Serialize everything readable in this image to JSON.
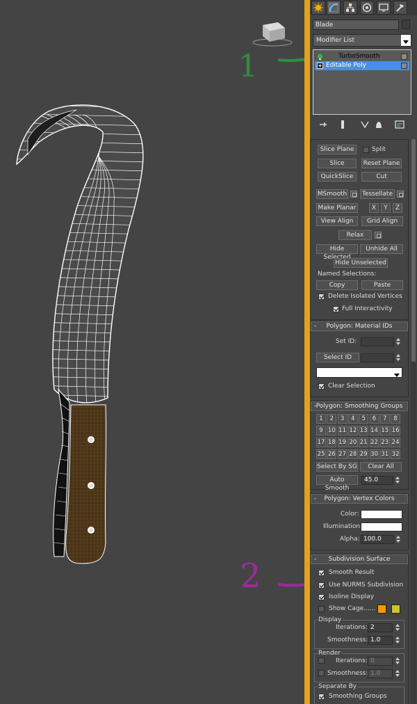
{
  "command_panel": {
    "tabs": [
      "create-icon",
      "modify-icon",
      "hierarchy-icon",
      "motion-icon",
      "display-icon",
      "utilities-icon"
    ],
    "object_name": "Blade",
    "modifier_list": "Modifier List",
    "stack": [
      {
        "label": "TurboSmooth"
      },
      {
        "label": "Editable Poly",
        "selected": true
      }
    ]
  },
  "viewport": {
    "annotations": [
      {
        "text": "1",
        "color": "#2f8f3f"
      },
      {
        "text": "2",
        "color": "#9a2c9a"
      }
    ]
  },
  "edit_geometry": {
    "slice_plane": "Slice Plane",
    "split": "Split",
    "slice": "Slice",
    "reset_plane": "Reset Plane",
    "quickslice": "QuickSlice",
    "cut": "Cut",
    "msmooth": "MSmooth",
    "tessellate": "Tessellate",
    "make_planar": "Make Planar",
    "x": "X",
    "y": "Y",
    "z": "Z",
    "view_align": "View Align",
    "grid_align": "Grid Align",
    "relax": "Relax",
    "hide_selected": "Hide Selected",
    "unhide_all": "Unhide All",
    "hide_unselected": "Hide Unselected",
    "named_selections": "Named Selections:",
    "copy": "Copy",
    "paste": "Paste",
    "delete_isolated": "Delete Isolated Vertices",
    "full_interactivity": "Full Interactivity"
  },
  "material_ids": {
    "title": "Polygon: Material IDs",
    "set_id": "Set ID:",
    "select_id": "Select ID",
    "clear_selection": "Clear Selection"
  },
  "smoothing_groups": {
    "title": "Polygon: Smoothing Groups",
    "numbers": [
      "1",
      "2",
      "3",
      "4",
      "5",
      "6",
      "7",
      "8",
      "9",
      "10",
      "11",
      "12",
      "13",
      "14",
      "15",
      "16",
      "17",
      "18",
      "19",
      "20",
      "21",
      "22",
      "23",
      "24",
      "25",
      "26",
      "27",
      "28",
      "29",
      "30",
      "31",
      "32"
    ],
    "select_by_sg": "Select By SG",
    "clear_all": "Clear All",
    "auto_smooth": "Auto Smooth",
    "auto_smooth_value": "45.0"
  },
  "vertex_colors": {
    "title": "Polygon: Vertex Colors",
    "color": "Color:",
    "illumination": "Illumination:",
    "alpha": "Alpha:",
    "alpha_value": "100.0"
  },
  "subdivision": {
    "title": "Subdivision Surface",
    "smooth_result": "Smooth Result",
    "use_nurms": "Use NURMS Subdivision",
    "isoline_display": "Isoline Display",
    "show_cage": "Show Cage......",
    "cage_color_1": "#f59a00",
    "cage_color_2": "#cfc42a",
    "display_label": "Display",
    "iterations": "Iterations:",
    "iterations_value": "2",
    "smoothness": "Smoothness:",
    "smoothness_value": "1.0",
    "render_label": "Render",
    "render_iterations": "Iterations:",
    "render_iterations_value": "0",
    "render_smoothness": "Smoothness:",
    "render_smoothness_value": "1.0",
    "separate_by": "Separate By",
    "smoothing_groups": "Smoothing Groups"
  }
}
